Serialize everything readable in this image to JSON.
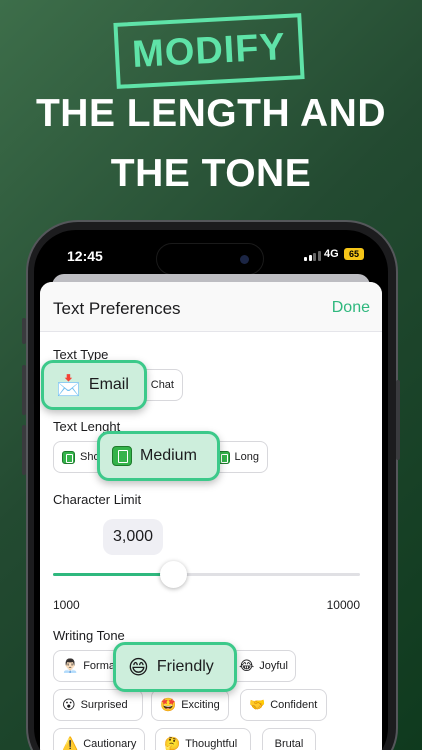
{
  "promo": {
    "badge": "MODIFY",
    "headline_line1": "THE LENGTH AND",
    "headline_line2": "THE TONE"
  },
  "status_bar": {
    "time": "12:45",
    "network": "4G",
    "battery": "65"
  },
  "sheet": {
    "title": "Text Preferences",
    "done_label": "Done"
  },
  "text_type": {
    "label": "Text Type",
    "options": [
      "Email",
      "Chat"
    ],
    "selected": "Email"
  },
  "text_length": {
    "label": "Text Lenght",
    "options": [
      "Sho",
      "Medium",
      "Long"
    ],
    "selected": "Medium"
  },
  "character_limit": {
    "label": "Character Limit",
    "value": "3,000",
    "min_label": "1000",
    "max_label": "10000",
    "min": 1000,
    "max": 10000,
    "current": 3000
  },
  "writing_tone": {
    "label": "Writing Tone",
    "options": [
      {
        "emoji": "👨🏻‍💼",
        "label": "Formal"
      },
      {
        "emoji": "😄",
        "label": "Friendly"
      },
      {
        "emoji": "😂",
        "label": "Joyful"
      },
      {
        "emoji": "😮",
        "label": "Surprised"
      },
      {
        "emoji": "🤩",
        "label": "Exciting"
      },
      {
        "emoji": "🤝",
        "label": "Confident"
      },
      {
        "emoji": "⚠️",
        "label": "Cautionary"
      },
      {
        "emoji": "🤔",
        "label": "Thoughtful"
      },
      {
        "emoji": "",
        "label": "Brutal"
      }
    ],
    "selected": "Friendly"
  },
  "icons": {
    "email": "📩",
    "chat": "chat-icon",
    "book": "green-book-icon"
  },
  "colors": {
    "accent": "#2fb87e",
    "badge": "#5fe3a8",
    "bubble_border": "#3cc98a",
    "bubble_fill": "#cdeedc"
  }
}
